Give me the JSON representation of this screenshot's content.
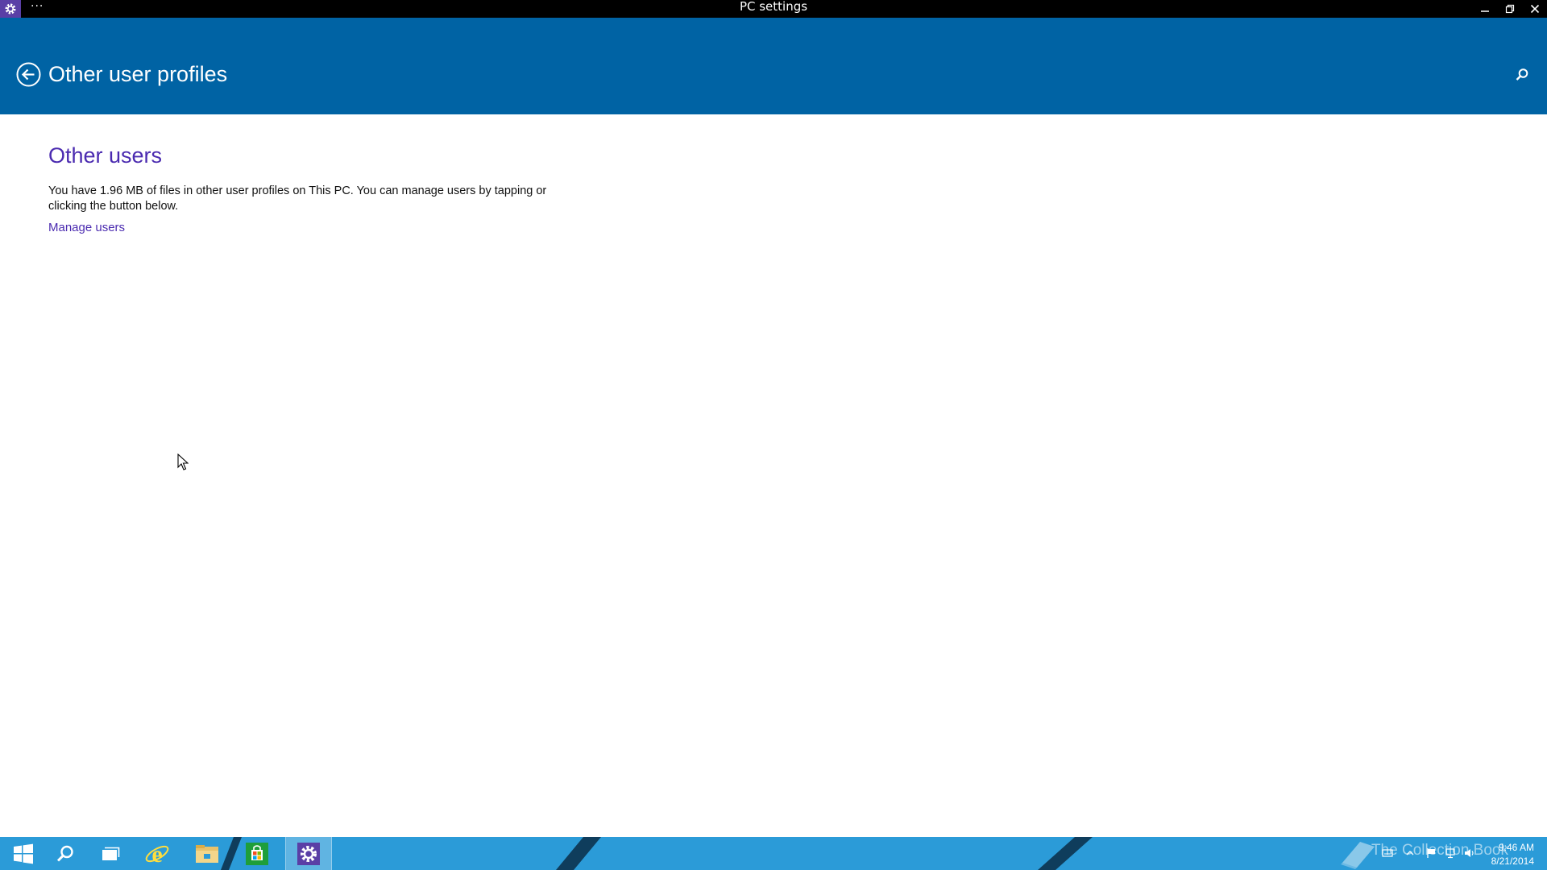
{
  "window": {
    "title": "PC settings",
    "menu_glyph": "···",
    "app_icon": "gear-icon"
  },
  "header": {
    "title": "Other user profiles",
    "back_icon": "back-arrow-icon",
    "search_icon": "search-icon"
  },
  "content": {
    "section_heading": "Other users",
    "description": "You have 1.96 MB of files in other user profiles on This PC. You can manage users by tapping or clicking the button below.",
    "link_label": "Manage users"
  },
  "taskbar": {
    "apps": [
      {
        "name": "start-button",
        "icon": "windows-logo-icon"
      },
      {
        "name": "search-button",
        "icon": "search-icon"
      },
      {
        "name": "task-view-button",
        "icon": "task-view-icon"
      },
      {
        "name": "internet-explorer-button",
        "icon": "internet-explorer-icon"
      },
      {
        "name": "file-explorer-button",
        "icon": "folder-icon"
      },
      {
        "name": "store-button",
        "icon": "store-icon"
      },
      {
        "name": "pc-settings-button",
        "icon": "gear-icon",
        "active": true
      }
    ],
    "watermark": "The Collection Book",
    "clock": {
      "time": "9:46 AM",
      "date": "8/21/2014"
    }
  },
  "colors": {
    "header_bg": "#0063a4",
    "accent": "#4b2bb0",
    "taskbar_bg": "#2b9bd8",
    "titlebar_bg": "#000000"
  }
}
